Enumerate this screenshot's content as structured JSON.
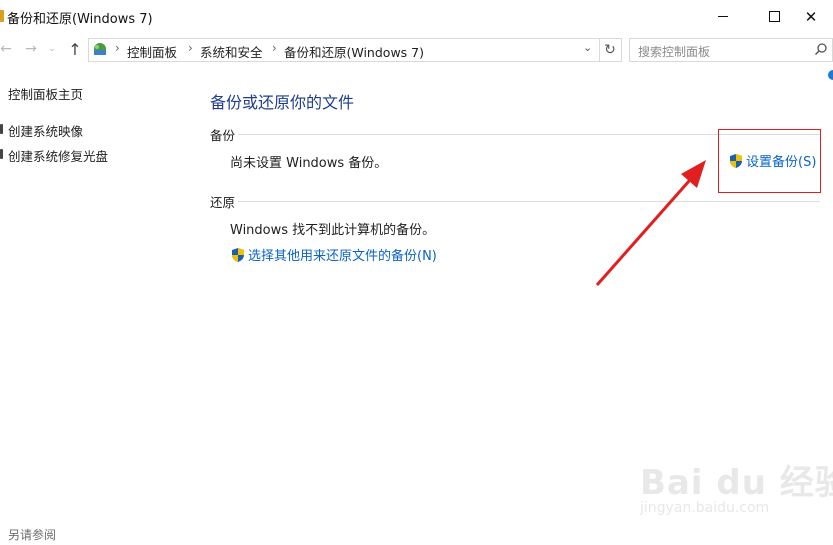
{
  "window": {
    "title": "备份和还原(Windows 7)",
    "controls": {
      "minimize": "",
      "maximize": "",
      "close": "✕"
    }
  },
  "nav": {
    "back": "←",
    "forward": "→",
    "recent": "⌄",
    "up": "↑",
    "breadcrumbs": [
      "控制面板",
      "系统和安全",
      "备份和还原(Windows 7)"
    ],
    "separator": "›",
    "dropdown": "⌄",
    "refresh": "↻",
    "search_placeholder": "搜索控制面板"
  },
  "sidebar": {
    "home_link": "控制面板主页",
    "links": [
      "创建系统映像",
      "创建系统修复光盘"
    ],
    "see_also": "另请参阅"
  },
  "main": {
    "title": "备份或还原你的文件",
    "backup": {
      "heading": "备份",
      "status": "尚未设置 Windows 备份。",
      "action": "设置备份(S)"
    },
    "restore": {
      "heading": "还原",
      "status": "Windows 找不到此计算机的备份。",
      "action": "选择其他用来还原文件的备份(N)"
    }
  },
  "watermark": {
    "main": "Bai du 经验",
    "sub": "jingyan.baidu.com"
  },
  "colors": {
    "link": "#0a63c9",
    "title": "#1e3d8f",
    "annotation": "#e02020"
  }
}
